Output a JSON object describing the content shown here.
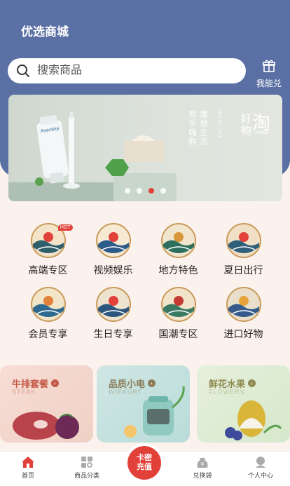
{
  "header": {
    "title": "优选商城"
  },
  "search": {
    "placeholder": "搜索商品"
  },
  "redeem": {
    "label": "我能兑"
  },
  "banner": {
    "col1": "欢乐嗨购",
    "col2": "理想生活",
    "col3": "IDEAL LIFE",
    "brand_a": "好物",
    "brand_b": "淘",
    "brand_c": "TAOWU",
    "tube_text": "AvecMoi",
    "active_index": 2,
    "dot_count": 4
  },
  "categories": [
    {
      "label": "高端专区",
      "badge": "HOT",
      "icon": "perfume-icon"
    },
    {
      "label": "视频娱乐",
      "icon": "video-play-icon"
    },
    {
      "label": "地方特色",
      "icon": "local-food-icon"
    },
    {
      "label": "夏日出行",
      "icon": "lotus-travel-icon"
    },
    {
      "label": "会员专享",
      "icon": "member-gift-icon"
    },
    {
      "label": "生日专享",
      "icon": "birthday-cake-icon"
    },
    {
      "label": "国潮专区",
      "icon": "palace-icon"
    },
    {
      "label": "进口好物",
      "icon": "swallow-icon"
    }
  ],
  "promos": [
    {
      "title": "牛排套餐",
      "sub": "STEAK",
      "color": "#c55a48",
      "icon": "steak-icon"
    },
    {
      "title": "品质小电",
      "sub": "WIEKURT",
      "color": "#8a7c5a",
      "icon": "air-fryer-icon"
    },
    {
      "title": "鲜花水果",
      "sub": "FLOWERS",
      "color": "#8f8a50",
      "icon": "fruit-flower-icon"
    }
  ],
  "tabs": [
    {
      "label": "首页",
      "icon": "home-icon"
    },
    {
      "label": "商品分类",
      "icon": "category-icon"
    },
    {
      "label": "兑换袋",
      "icon": "bag-icon"
    },
    {
      "label": "个人中心",
      "icon": "user-icon"
    }
  ],
  "center_button": {
    "line1": "卡密",
    "line2": "充值"
  },
  "colors": {
    "header": "#5a6fa3",
    "accent": "#e2413a",
    "page_bg": "#fbf2ee"
  }
}
